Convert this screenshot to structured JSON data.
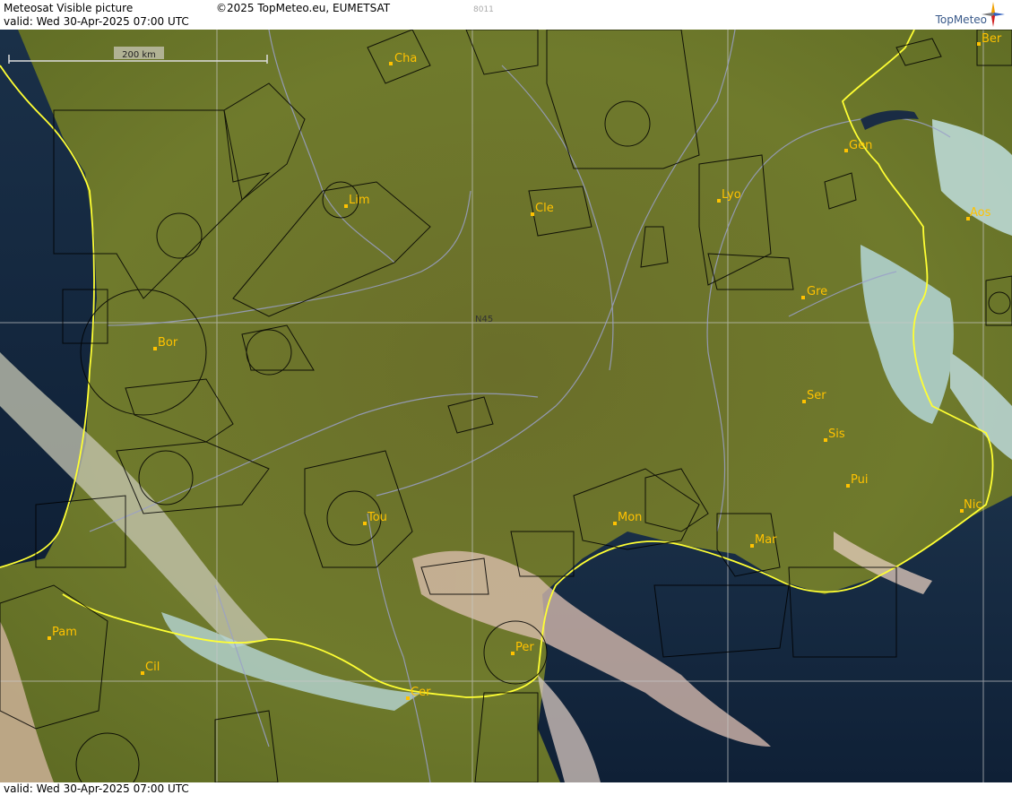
{
  "header": {
    "title": "Meteosat Visible picture",
    "copyright": "©2025 TopMeteo.eu, EUMETSAT",
    "code": "8011",
    "valid": "valid:  Wed  30-Apr-2025  07:00 UTC",
    "brand": "TopMeteo"
  },
  "footer": {
    "valid": "valid:  Wed  30-Apr-2025  07:00 UTC"
  },
  "map": {
    "scale_label": "200 km",
    "latitude_label": "N45",
    "colors": {
      "land": "#6b7428",
      "sea": "#13263f",
      "border": "#ffff33",
      "rivers": "#9aa0c8",
      "city": "#ffc200",
      "grid": "#c8c8c8"
    },
    "cities": [
      {
        "id": "cha",
        "name": "Cha"
      },
      {
        "id": "ber",
        "name": "Ber"
      },
      {
        "id": "gen",
        "name": "Gen"
      },
      {
        "id": "lim",
        "name": "Lim"
      },
      {
        "id": "cle",
        "name": "Cle"
      },
      {
        "id": "lyo",
        "name": "Lyo"
      },
      {
        "id": "aos",
        "name": "Aos"
      },
      {
        "id": "gre",
        "name": "Gre"
      },
      {
        "id": "bor",
        "name": "Bor"
      },
      {
        "id": "ser",
        "name": "Ser"
      },
      {
        "id": "sis",
        "name": "Sis"
      },
      {
        "id": "pui",
        "name": "Pui"
      },
      {
        "id": "nic",
        "name": "Nic"
      },
      {
        "id": "tou",
        "name": "Tou"
      },
      {
        "id": "mon",
        "name": "Mon"
      },
      {
        "id": "mar",
        "name": "Mar"
      },
      {
        "id": "pam",
        "name": "Pam"
      },
      {
        "id": "per",
        "name": "Per"
      },
      {
        "id": "cil",
        "name": "Cil"
      },
      {
        "id": "cer",
        "name": "Cer"
      }
    ]
  }
}
